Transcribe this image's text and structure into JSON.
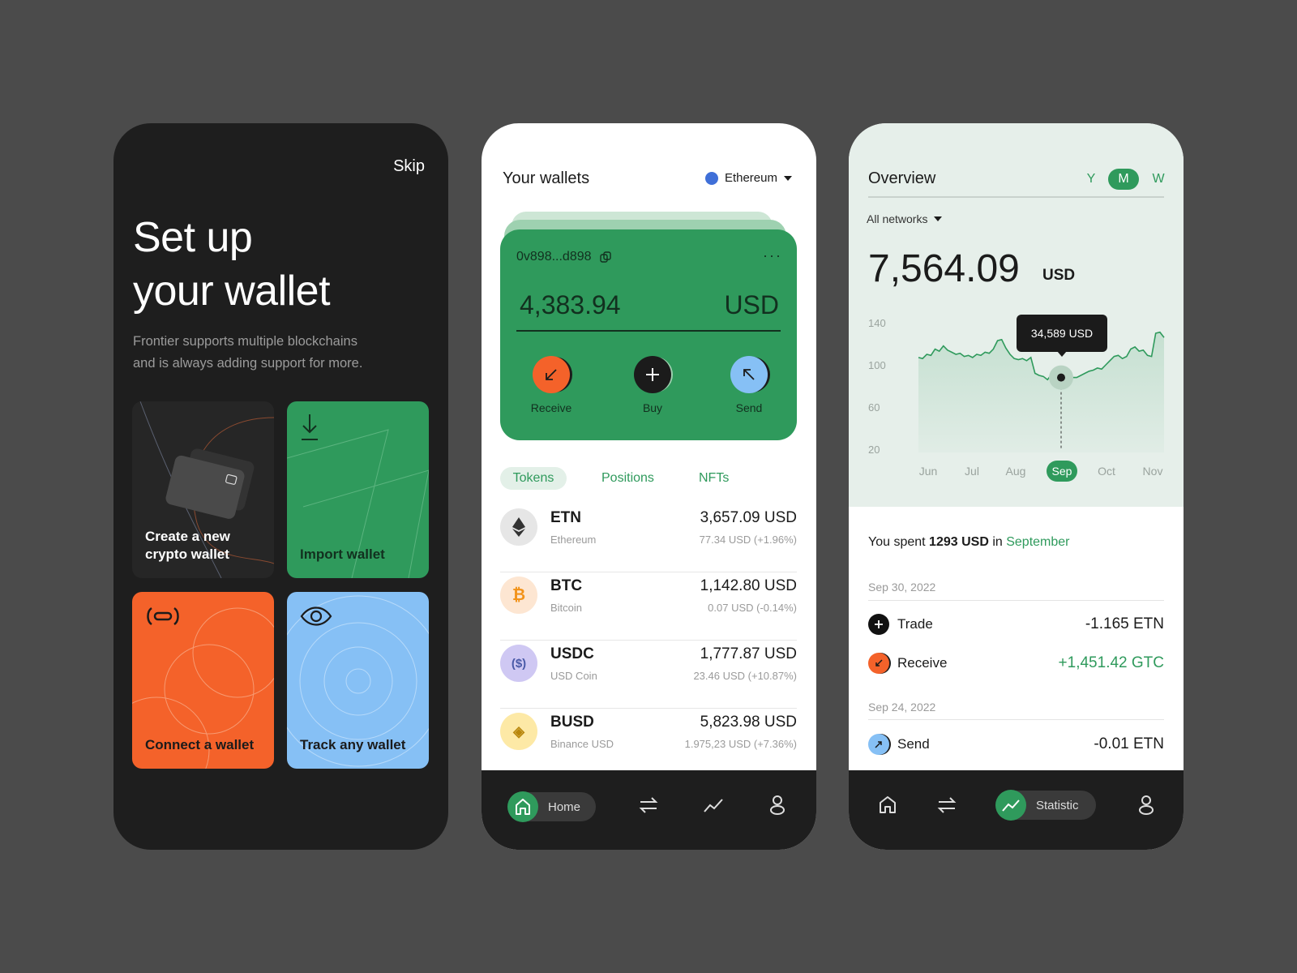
{
  "setup": {
    "skip": "Skip",
    "title_line1": "Set up",
    "title_line2": "your wallet",
    "subtitle_line1": "Frontier supports multiple blockchains",
    "subtitle_line2": "and is always adding support for more.",
    "tiles": [
      {
        "label_line1": "Create a new",
        "label_line2": "crypto wallet",
        "color": "#262626",
        "icon": "card-icon"
      },
      {
        "label": "Import wallet",
        "color": "#2f9a5c",
        "icon": "download-icon"
      },
      {
        "label": "Connect a wallet",
        "color": "#f4622a",
        "icon": "link-icon"
      },
      {
        "label": "Track any wallet",
        "color": "#86c0f5",
        "icon": "eye-icon"
      }
    ]
  },
  "wallets": {
    "title": "Your wallets",
    "network": "Ethereum",
    "card": {
      "address": "0v898...d898",
      "balance": "4,383.94",
      "currency": "USD",
      "actions": [
        {
          "label": "Receive",
          "color": "#f4622a"
        },
        {
          "label": "Buy",
          "color": "#1b1b1b"
        },
        {
          "label": "Send",
          "color": "#86c0f5"
        }
      ]
    },
    "tabs": [
      "Tokens",
      "Positions",
      "NFTs"
    ],
    "active_tab": "Tokens",
    "tokens": [
      {
        "symbol": "ETN",
        "name": "Ethereum",
        "value": "3,657.09 USD",
        "change": "77.34 USD (+1.96%)"
      },
      {
        "symbol": "BTC",
        "name": "Bitcoin",
        "value": "1,142.80 USD",
        "change": "0.07 USD (-0.14%)"
      },
      {
        "symbol": "USDC",
        "name": "USD Coin",
        "value": "1,777.87 USD",
        "change": "23.46 USD (+10.87%)"
      },
      {
        "symbol": "BUSD",
        "name": "Binance USD",
        "value": "5,823.98 USD",
        "change": "1.975,23 USD (+7.36%)"
      }
    ],
    "nav": {
      "home": "Home"
    }
  },
  "overview": {
    "title": "Overview",
    "periods": [
      "Y",
      "M",
      "W"
    ],
    "active_period": "M",
    "network_filter": "All networks",
    "total": "7,564.09",
    "currency": "USD",
    "tooltip": "34,589 USD",
    "spent_prefix": "You spent",
    "spent_amount": "1293 USD",
    "spent_mid": "in",
    "spent_month": "September",
    "groups": [
      {
        "date": "Sep 30, 2022",
        "items": [
          {
            "label": "Trade",
            "amount": "-1.165 ETN",
            "icon": "plus-icon"
          },
          {
            "label": "Receive",
            "amount": "+1,451.42 GTC",
            "icon": "arrow-down-left-icon",
            "positive": true
          }
        ]
      },
      {
        "date": "Sep 24, 2022",
        "items": [
          {
            "label": "Send",
            "amount": "-0.01 ETN",
            "icon": "arrow-up-right-icon"
          }
        ]
      }
    ],
    "nav": {
      "statistic": "Statistic"
    }
  },
  "chart_data": {
    "type": "area",
    "x_labels": [
      "Jun",
      "Jul",
      "Aug",
      "Sep",
      "Oct",
      "Nov"
    ],
    "highlighted_x": "Sep",
    "y_ticks": [
      140,
      100,
      60,
      20
    ],
    "ylim": [
      20,
      140
    ],
    "grid": false,
    "line_color": "#2f9a5c",
    "values": [
      107,
      106,
      110,
      109,
      115,
      113,
      118,
      114,
      112,
      110,
      111,
      108,
      109,
      107,
      110,
      109,
      112,
      111,
      115,
      123,
      124,
      116,
      110,
      106,
      105,
      106,
      104,
      107,
      92,
      90,
      89,
      86,
      91,
      84,
      89,
      88,
      90,
      88,
      88,
      90,
      92,
      94,
      95,
      97,
      96,
      100,
      104,
      108,
      109,
      106,
      108,
      115,
      117,
      113,
      114,
      109,
      108,
      130,
      131,
      126
    ]
  }
}
